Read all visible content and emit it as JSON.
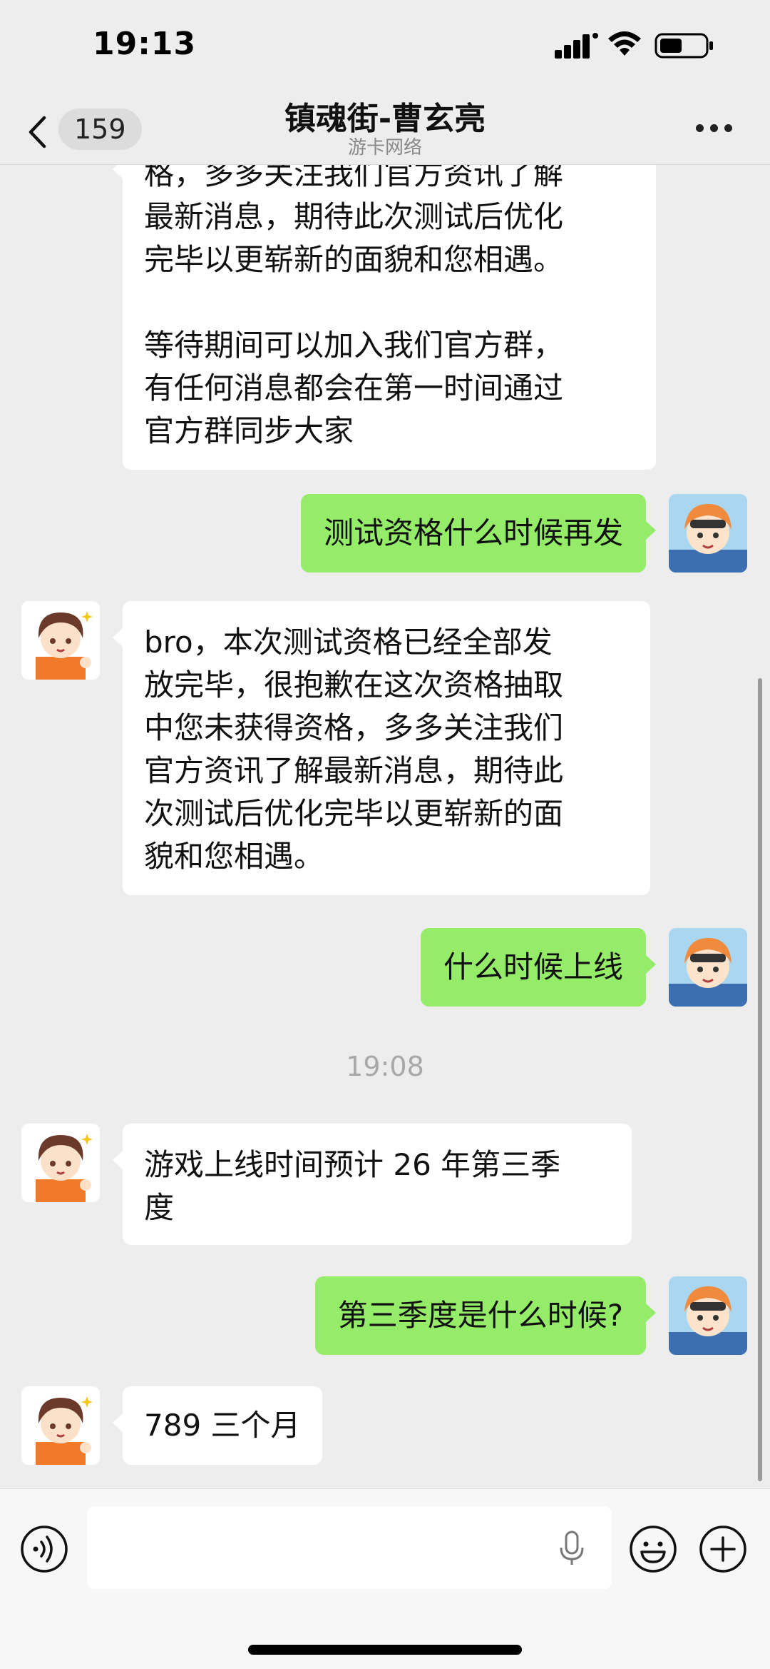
{
  "status_bar": {
    "time": "19:13"
  },
  "nav": {
    "back_count": "159",
    "title": "镇魂街-曹玄亮",
    "subtitle": "游卡网络"
  },
  "messages": [
    {
      "side": "in",
      "text": "格，多多关注我们官方资讯了解\n最新消息，期待此次测试后优化\n完毕以更崭新的面貌和您相遇。\n\n等待期间可以加入我们官方群，\n有任何消息都会在第一时间通过\n官方群同步大家"
    },
    {
      "side": "out",
      "text": "测试资格什么时候再发"
    },
    {
      "side": "in",
      "text": "bro，本次测试资格已经全部发\n放完毕，很抱歉在这次资格抽取\n中您未获得资格，多多关注我们\n官方资讯了解最新消息，期待此\n次测试后优化完毕以更崭新的面\n貌和您相遇。"
    },
    {
      "side": "out",
      "text": "什么时候上线"
    },
    {
      "side": "in",
      "text": "游戏上线时间预计 26 年第三季\n度"
    },
    {
      "side": "out",
      "text": "第三季度是什么时候?"
    },
    {
      "side": "in",
      "text": "789 三个月"
    }
  ],
  "time_divider": "19:08",
  "input_bar": {
    "placeholder": ""
  },
  "colors": {
    "outgoing_bubble": "#95ec69",
    "incoming_bubble": "#ffffff",
    "background": "#ededed"
  },
  "icons": [
    "back-chevron-icon",
    "more-icon",
    "voice-icon",
    "mic-icon",
    "emoji-icon",
    "plus-icon"
  ]
}
